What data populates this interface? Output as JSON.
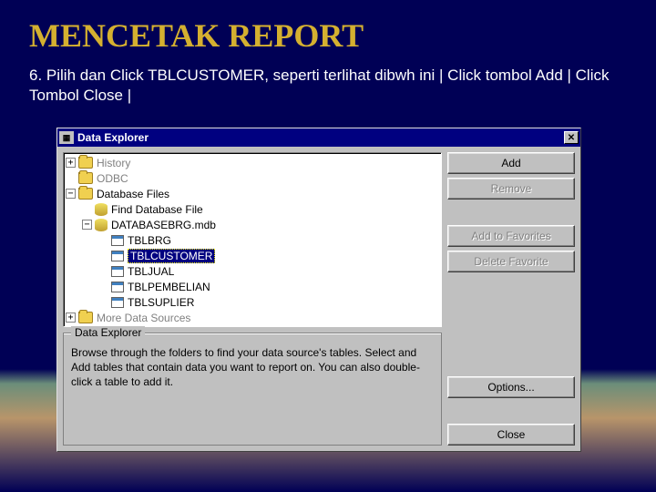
{
  "slide": {
    "title": "MENCETAK  REPORT",
    "instruction": "6. Pilih dan Click TBLCUSTOMER,  seperti terlihat dibwh ini  |  Click tombol  Add  | Click Tombol Close  |"
  },
  "dialog": {
    "title": "Data Explorer",
    "tree": {
      "history": "History",
      "odbc": "ODBC",
      "dbfiles": "Database Files",
      "find": "Find Database File",
      "dbname": "DATABASEBRG.mdb",
      "tables": [
        "TBLBRG",
        "TBLCUSTOMER",
        "TBLJUAL",
        "TBLPEMBELIAN",
        "TBLSUPLIER"
      ],
      "more": "More Data Sources",
      "selected_index": 1
    },
    "help": {
      "legend": "Data Explorer",
      "text": "Browse through the folders to find your data source's tables.  Select and Add tables that contain data you want to report on.  You can also double-click a table to add it."
    },
    "buttons": {
      "add": "Add",
      "remove": "Remove",
      "add_fav": "Add to Favorites",
      "del_fav": "Delete Favorite",
      "options": "Options...",
      "close": "Close"
    }
  }
}
